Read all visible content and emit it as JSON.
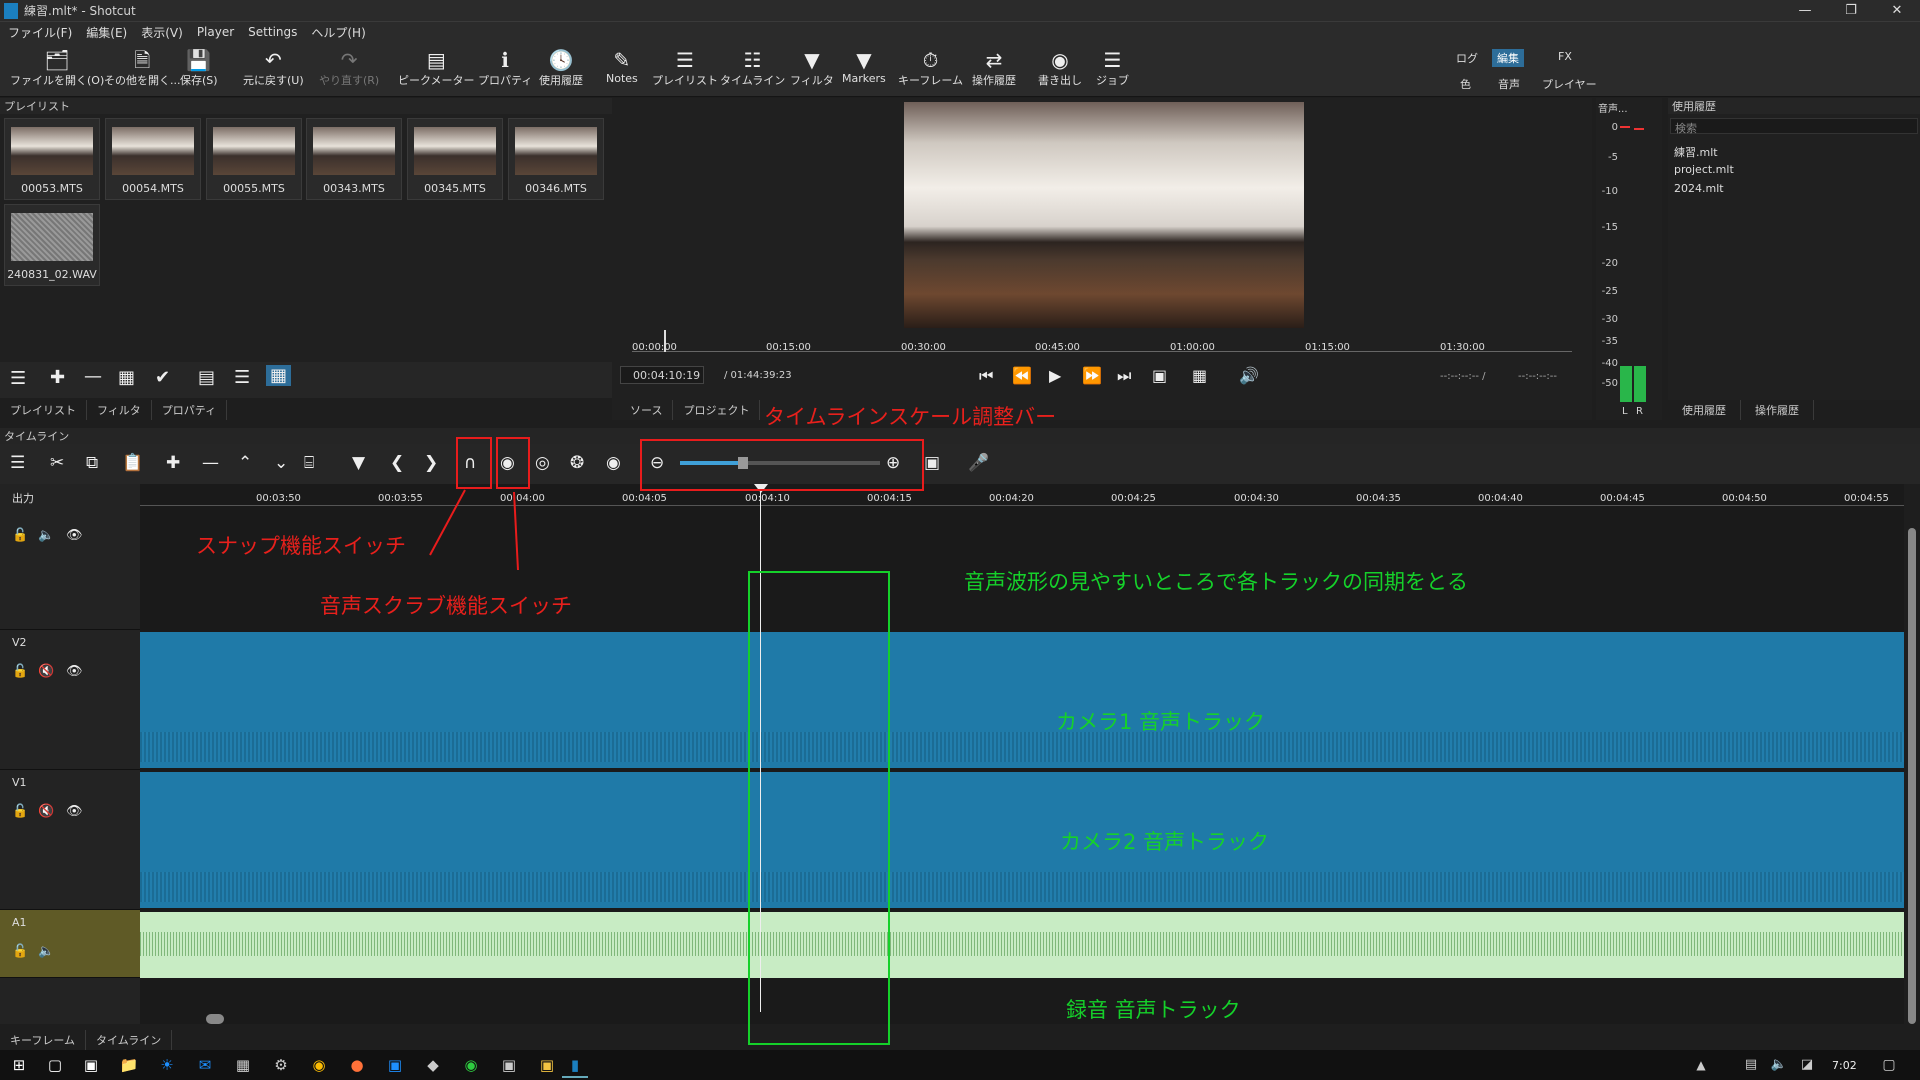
{
  "window": {
    "title": "練習.mlt* - Shotcut"
  },
  "menu": [
    "ファイル(F)",
    "編集(E)",
    "表示(V)",
    "Player",
    "Settings",
    "ヘルプ(H)"
  ],
  "toolbar": [
    {
      "label": "ファイルを開く(O)",
      "icon": "folder-open-icon"
    },
    {
      "label": "その他を開く...",
      "icon": "open-other-icon"
    },
    {
      "label": "保存(S)",
      "icon": "save-icon"
    },
    {
      "label": "元に戻す(U)",
      "icon": "undo-icon"
    },
    {
      "label": "やり直す(R)",
      "icon": "redo-icon"
    },
    {
      "label": "ピークメーター",
      "icon": "peak-meter-icon"
    },
    {
      "label": "プロパティ",
      "icon": "info-icon"
    },
    {
      "label": "使用履歴",
      "icon": "history-icon"
    },
    {
      "label": "Notes",
      "icon": "notes-icon"
    },
    {
      "label": "プレイリスト",
      "icon": "list-icon"
    },
    {
      "label": "タイムライン",
      "icon": "timeline-icon"
    },
    {
      "label": "フィルタ",
      "icon": "filter-icon"
    },
    {
      "label": "Markers",
      "icon": "marker-icon"
    },
    {
      "label": "キーフレーム",
      "icon": "stopwatch-icon"
    },
    {
      "label": "操作履歴",
      "icon": "undo-history-icon"
    },
    {
      "label": "書き出し",
      "icon": "export-icon"
    },
    {
      "label": "ジョブ",
      "icon": "jobs-icon"
    }
  ],
  "workspace": {
    "row1": [
      "ログ",
      "編集",
      "FX"
    ],
    "row2": [
      "色",
      "音声",
      "プレイヤー"
    ],
    "active": "編集"
  },
  "playlist": {
    "title": "プレイリスト",
    "items": [
      "00053.MTS",
      "00054.MTS",
      "00055.MTS",
      "00343.MTS",
      "00345.MTS",
      "00346.MTS",
      "240831_02.WAV"
    ],
    "tabs": [
      "プレイリスト",
      "フィルタ",
      "プロパティ"
    ]
  },
  "player": {
    "ruler": [
      "00:00:00",
      "00:15:00",
      "00:30:00",
      "00:45:00",
      "01:00:00",
      "01:15:00",
      "01:30:00"
    ],
    "timecode": "00:04:10:19",
    "duration": "/ 01:44:39:23",
    "in_out": "--:--:--:-- /",
    "in_out2": "--:--:--:--",
    "tabs": [
      "ソース",
      "プロジェクト"
    ]
  },
  "audio_meter": {
    "title": "音声...",
    "scale": [
      "0",
      "-5",
      "-10",
      "-15",
      "-20",
      "-25",
      "-30",
      "-35",
      "-40",
      "-50"
    ],
    "channels": [
      "L",
      "R"
    ]
  },
  "recent": {
    "title": "使用履歴",
    "search_placeholder": "検索",
    "items": [
      "練習.mlt",
      "project.mlt",
      "2024.mlt"
    ],
    "tabs": [
      "使用履歴",
      "操作履歴"
    ]
  },
  "timeline": {
    "title": "タイムライン",
    "output_label": "出力",
    "ruler": [
      "00:03:50",
      "00:03:55",
      "00:04:00",
      "00:04:05",
      "00:04:10",
      "00:04:15",
      "00:04:20",
      "00:04:25",
      "00:04:30",
      "00:04:35",
      "00:04:40",
      "00:04:45",
      "00:04:50",
      "00:04:55"
    ],
    "tracks": [
      "V2",
      "V1",
      "A1"
    ],
    "zoom_level": 0.3
  },
  "bottom_tabs": [
    "キーフレーム",
    "タイムライン"
  ],
  "annotations": {
    "scale_bar": "タイムラインスケール調整バー",
    "snap": "スナップ機能スイッチ",
    "scrub": "音声スクラブ機能スイッチ",
    "sync_note": "音声波形の見やすいところで各トラックの同期をとる",
    "cam1": "カメラ1 音声トラック",
    "cam2": "カメラ2 音声トラック",
    "rec": "録音 音声トラック"
  },
  "taskbar": {
    "time": "7:02"
  },
  "colors": {
    "video_track": "#1f7aa8",
    "audio_track": "#c8ecc4",
    "accent": "#2d6d99",
    "annotation_red": "#e8201c",
    "annotation_green": "#15d12a"
  }
}
